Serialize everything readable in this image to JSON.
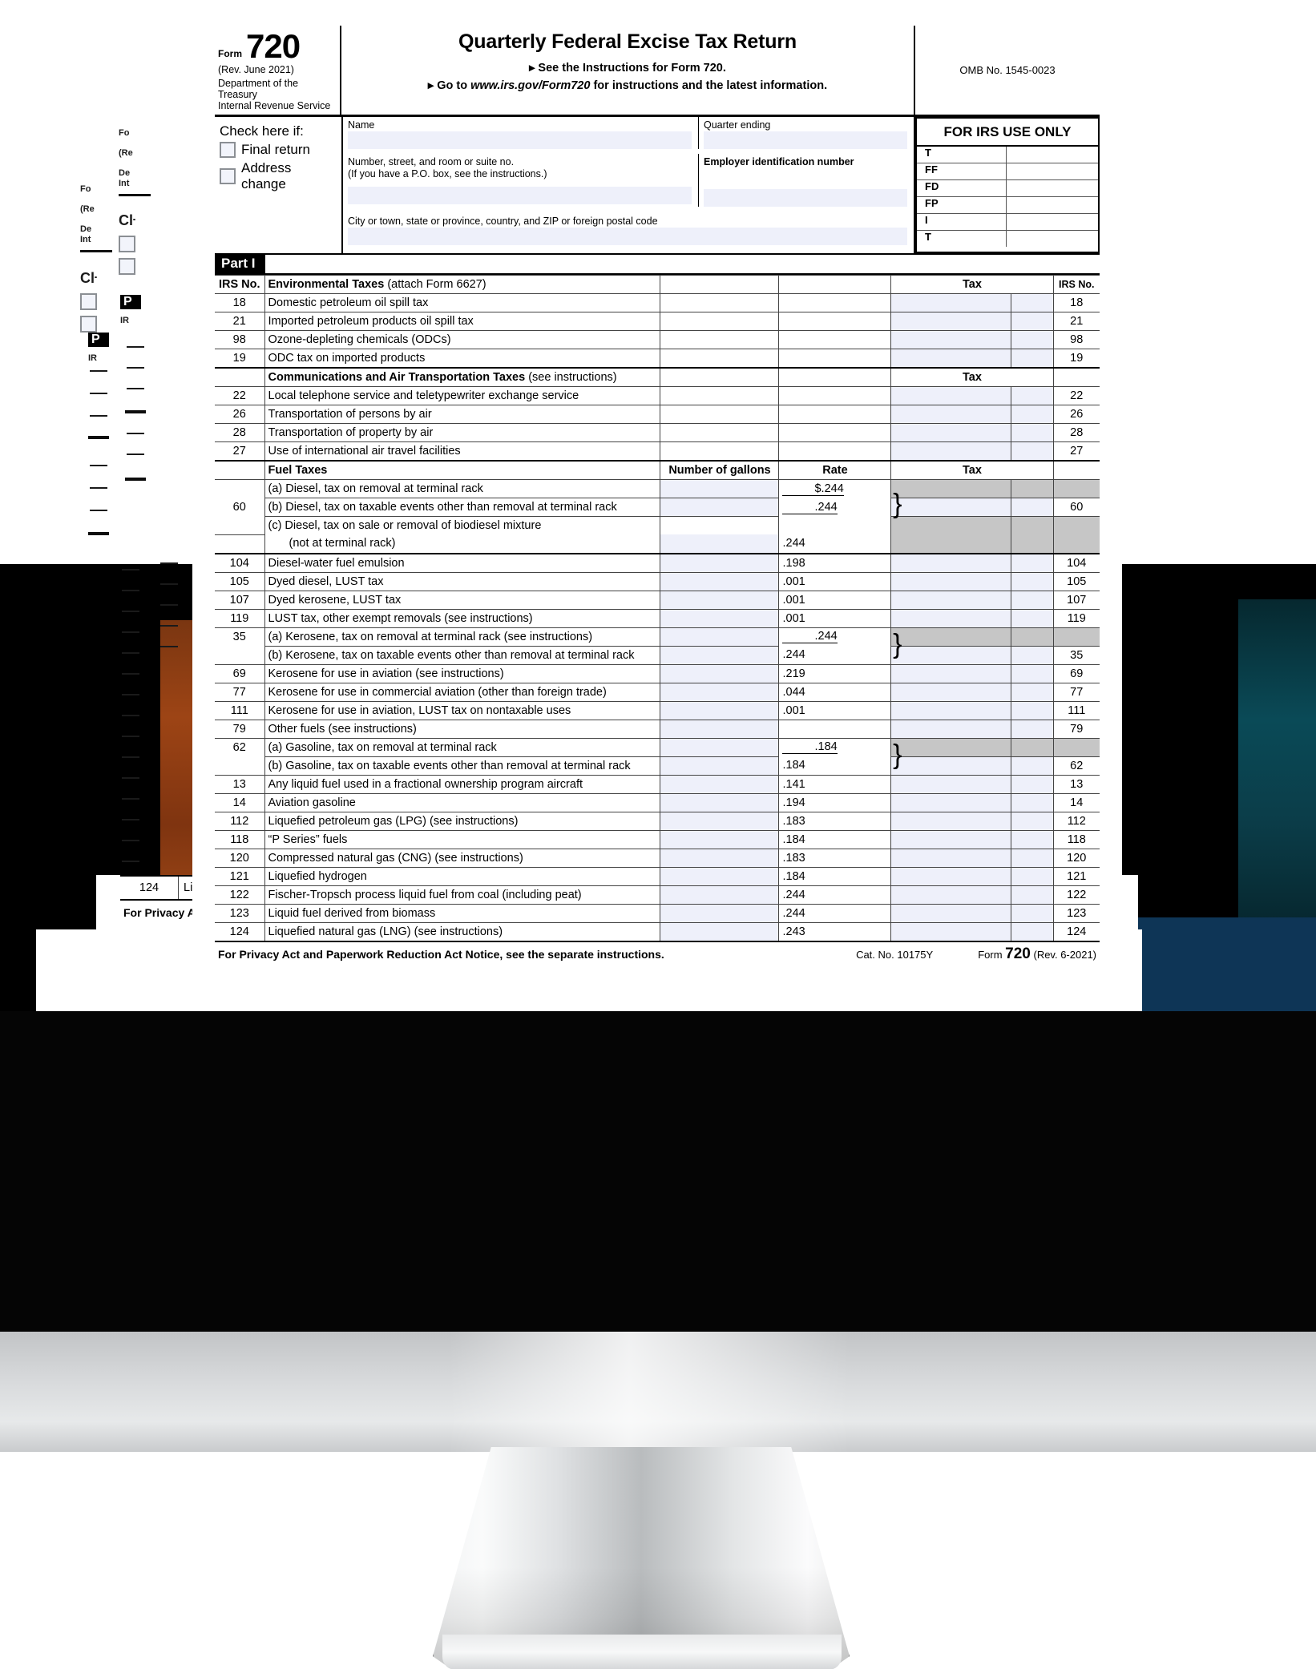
{
  "form": {
    "label_form": "Form",
    "number": "720",
    "revision": "(Rev. June 2021)",
    "department_line1": "Department of the Treasury",
    "department_line2": "Internal Revenue Service",
    "title": "Quarterly Federal Excise Tax Return",
    "instruction_1": "See the Instructions for Form 720.",
    "instruction_2_pre": "Go to ",
    "instruction_2_url": "www.irs.gov/Form720",
    "instruction_2_post": " for instructions and the latest information.",
    "omb": "OMB No. 1545-0023"
  },
  "check_here": {
    "title": "Check here if:",
    "options": [
      "Final return",
      "Address change"
    ]
  },
  "identity": {
    "name_label": "Name",
    "quarter_label": "Quarter ending",
    "street_label_line1": "Number, street, and room or suite no.",
    "street_label_line2": "(If you have a P.O. box, see the instructions.)",
    "ein_label": "Employer identification number",
    "city_label": "City or town, state or province, country, and ZIP or foreign postal code"
  },
  "irs_use": {
    "title": "FOR IRS USE ONLY",
    "rows": [
      "T",
      "FF",
      "FD",
      "FP",
      "I",
      "T"
    ]
  },
  "part": {
    "label": "Part I"
  },
  "columns": {
    "irs_no": "IRS No.",
    "tax": "Tax",
    "irs_no_right": "IRS No.",
    "gallons": "Number of gallons",
    "rate": "Rate"
  },
  "sections": {
    "environmental": "Environmental Taxes",
    "environmental_note": "(attach Form 6627)",
    "communications": "Communications and Air Transportation Taxes",
    "communications_note": "(see instructions)",
    "fuel": "Fuel Taxes"
  },
  "rows_environmental": [
    {
      "no": "18",
      "desc": "Domestic petroleum oil spill tax",
      "right": "18"
    },
    {
      "no": "21",
      "desc": "Imported petroleum products oil spill tax",
      "right": "21"
    },
    {
      "no": "98",
      "desc": "Ozone-depleting chemicals (ODCs)",
      "right": "98"
    },
    {
      "no": "19",
      "desc": "ODC tax on imported products",
      "right": "19"
    }
  ],
  "rows_communications": [
    {
      "no": "22",
      "desc": "Local telephone service and teletypewriter exchange service",
      "right": "22"
    },
    {
      "no": "26",
      "desc": "Transportation of persons by air",
      "right": "26"
    },
    {
      "no": "28",
      "desc": "Transportation of property by air",
      "right": "28"
    },
    {
      "no": "27",
      "desc": "Use of international air travel facilities",
      "right": "27"
    }
  ],
  "rows_fuel": [
    {
      "no": "",
      "desc": "(a)  Diesel, tax on removal at terminal rack",
      "rate": "$.244",
      "right": "",
      "shaded": true
    },
    {
      "no": "60",
      "desc": "(b)  Diesel, tax on taxable events other than removal at terminal rack",
      "rate": ".244",
      "right": "60",
      "shaded": false
    },
    {
      "no": "",
      "desc": "(c)  Diesel, tax on sale or removal of biodiesel mixture",
      "desc2": "(not at terminal rack)",
      "rate": ".244",
      "right": "",
      "shaded": true
    },
    {
      "no": "104",
      "desc": "Diesel-water fuel emulsion",
      "rate": ".198",
      "right": "104",
      "shaded": false
    },
    {
      "no": "105",
      "desc": "Dyed diesel, LUST tax",
      "rate": ".001",
      "right": "105",
      "shaded": false
    },
    {
      "no": "107",
      "desc": "Dyed kerosene, LUST tax",
      "rate": ".001",
      "right": "107",
      "shaded": false
    },
    {
      "no": "119",
      "desc": "LUST tax, other exempt removals (see instructions)",
      "rate": ".001",
      "right": "119",
      "shaded": false
    },
    {
      "no": "35",
      "desc": "(a)  Kerosene, tax on removal at terminal rack (see instructions)",
      "rate": ".244",
      "right": "",
      "shaded": true
    },
    {
      "no": "",
      "desc": "(b)  Kerosene, tax on taxable events other than removal at terminal rack",
      "rate": ".244",
      "right": "35",
      "shaded": false
    },
    {
      "no": "69",
      "desc": "Kerosene for use in aviation (see instructions)",
      "rate": ".219",
      "right": "69",
      "shaded": false
    },
    {
      "no": "77",
      "desc": "Kerosene for use in commercial aviation (other than foreign trade)",
      "rate": ".044",
      "right": "77",
      "shaded": false
    },
    {
      "no": "111",
      "desc": "Kerosene for use in aviation, LUST tax on nontaxable uses",
      "rate": ".001",
      "right": "111",
      "shaded": false
    },
    {
      "no": "79",
      "desc": "Other fuels (see instructions)",
      "rate": "",
      "right": "79",
      "shaded": false
    },
    {
      "no": "62",
      "desc": "(a)  Gasoline, tax on removal at terminal rack",
      "rate": ".184",
      "right": "",
      "shaded": true
    },
    {
      "no": "",
      "desc": "(b)  Gasoline, tax on taxable events other than removal at terminal rack",
      "rate": ".184",
      "right": "62",
      "shaded": false
    },
    {
      "no": "13",
      "desc": "Any liquid fuel used in a fractional ownership program aircraft",
      "rate": ".141",
      "right": "13",
      "shaded": false
    },
    {
      "no": "14",
      "desc": "Aviation gasoline",
      "rate": ".194",
      "right": "14",
      "shaded": false
    },
    {
      "no": "112",
      "desc": "Liquefied petroleum gas (LPG) (see instructions)",
      "rate": ".183",
      "right": "112",
      "shaded": false
    },
    {
      "no": "118",
      "desc": "“P Series” fuels",
      "rate": ".184",
      "right": "118",
      "shaded": false
    },
    {
      "no": "120",
      "desc": "Compressed natural gas (CNG) (see instructions)",
      "rate": ".183",
      "right": "120",
      "shaded": false
    },
    {
      "no": "121",
      "desc": "Liquefied hydrogen",
      "rate": ".184",
      "right": "121",
      "shaded": false
    },
    {
      "no": "122",
      "desc": "Fischer-Tropsch process liquid fuel from coal (including peat)",
      "rate": ".244",
      "right": "122",
      "shaded": false
    },
    {
      "no": "123",
      "desc": "Liquid fuel derived from biomass",
      "rate": ".244",
      "right": "123",
      "shaded": false
    },
    {
      "no": "124",
      "desc": "Liquefied natural gas (LNG) (see instructions)",
      "rate": ".243",
      "right": "124",
      "shaded": false
    }
  ],
  "footer": {
    "privacy": "For Privacy Act and Paperwork Reduction Act Notice, see the separate instructions.",
    "catalog": "Cat. No. 10175Y",
    "form_label": "Form",
    "form_number": "720",
    "form_rev": "(Rev. 6-2021)"
  },
  "last_row": {
    "no": "124",
    "desc": "Liquefied natural gas (LNG) (see instructions)",
    "rate": ".243",
    "right": "124"
  }
}
